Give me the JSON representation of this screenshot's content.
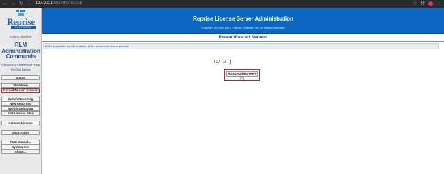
{
  "browser": {
    "url_host": "127.0.0.1",
    "url_rest": ":5054/home.asp",
    "nav_icons": [
      "back-icon",
      "forward-icon",
      "reload-icon",
      "info-icon"
    ],
    "right_icons": [
      "star-icon",
      "extension-icon",
      "avatar",
      "menu-icon"
    ]
  },
  "sidebar": {
    "logo_word": "Reprise",
    "logo_sub": "SOFTWARE",
    "login_status": "Logins disabled",
    "panel_title": "RLM Administration Commands",
    "choose_text": "Choose a command from the list below",
    "buttons": [
      {
        "label": "Status",
        "active": false
      },
      {
        "label": "Shutdown",
        "active": false
      },
      {
        "label": "Reread/Restart Servers",
        "active": true
      },
      {
        "label": "Switch Reportlog",
        "active": false
      },
      {
        "label": "New Reportlog",
        "active": false
      },
      {
        "label": "Switch Debuglog",
        "active": false
      },
      {
        "label": "Edit License Files",
        "active": false
      },
      {
        "label": "Activate License",
        "active": false
      },
      {
        "label": "Diagnostics",
        "active": false
      },
      {
        "label": "RLM Manual...",
        "active": false
      },
      {
        "label": "System Info",
        "active": false
      },
      {
        "label": "About...",
        "active": false
      }
    ]
  },
  "header": {
    "title": "Reprise License Server Administration",
    "copyright": "Copyright (c) 2006-2017, Reprise Software, Inc. All Rights Reserved."
  },
  "main": {
    "title": "Reread/Restart Servers",
    "info": "If ISV is specified as \"all\" or blank, all ISV servers will reread licenses",
    "isv_label": "ISV:",
    "isv_value": "all",
    "reread_button": "REREAD/RESTART"
  },
  "colors": {
    "header_bg": "#0b67c1",
    "title_blue": "#1c4f86",
    "highlight_red": "#e0141b",
    "sidebar_bg": "#e9e9e9"
  }
}
